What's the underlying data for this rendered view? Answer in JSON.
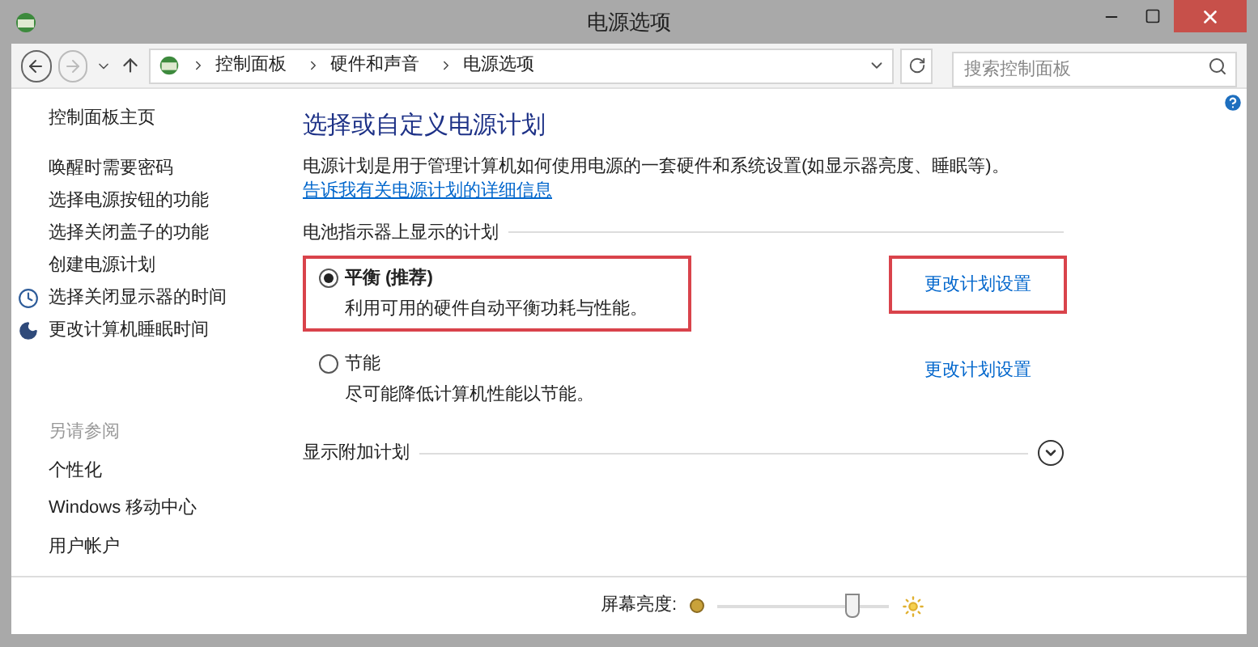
{
  "window": {
    "title": "电源选项"
  },
  "breadcrumb": [
    "控制面板",
    "硬件和声音",
    "电源选项"
  ],
  "search": {
    "placeholder": "搜索控制面板"
  },
  "sidebar": {
    "home": "控制面板主页",
    "items": [
      {
        "label": "唤醒时需要密码",
        "kind": "plain"
      },
      {
        "label": "选择电源按钮的功能",
        "kind": "plain"
      },
      {
        "label": "选择关闭盖子的功能",
        "kind": "plain"
      },
      {
        "label": "创建电源计划",
        "kind": "plain"
      },
      {
        "label": "选择关闭显示器的时间",
        "kind": "clock"
      },
      {
        "label": "更改计算机睡眠时间",
        "kind": "moon"
      }
    ],
    "see_also_heading": "另请参阅",
    "see_also": [
      "个性化",
      "Windows 移动中心",
      "用户帐户"
    ]
  },
  "main": {
    "heading": "选择或自定义电源计划",
    "description": "电源计划是用于管理计算机如何使用电源的一套硬件和系统设置(如显示器亮度、睡眠等)。",
    "description_link": "告诉我有关电源计划的详细信息",
    "section": "电池指示器上显示的计划",
    "plans": [
      {
        "name": "平衡 (推荐)",
        "description": "利用可用的硬件自动平衡功耗与性能。",
        "selected": true,
        "highlighted": true,
        "link": "更改计划设置"
      },
      {
        "name": "节能",
        "description": "尽可能降低计算机性能以节能。",
        "selected": false,
        "highlighted": false,
        "link": "更改计划设置"
      }
    ],
    "more_plans": "显示附加计划"
  },
  "brightness": {
    "label": "屏幕亮度:",
    "level": 0.78
  }
}
